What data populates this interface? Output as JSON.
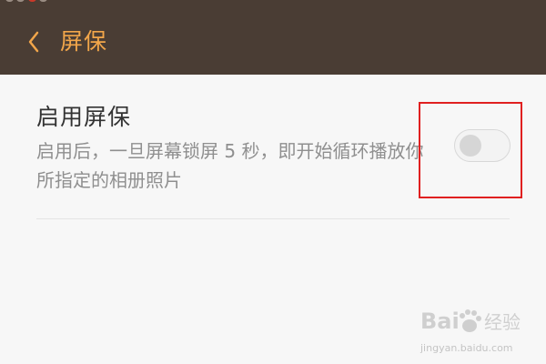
{
  "header": {
    "title": "屏保",
    "back_icon": "chevron-left-icon"
  },
  "setting": {
    "title": "启用屏保",
    "description": "启用后，一旦屏幕锁屏 5 秒，即开始循环播放你所指定的相册照片",
    "toggle_on": false
  },
  "watermark": {
    "text": "Bai经验",
    "url": "jingyan.baidu.com"
  },
  "colors": {
    "header_bg": "#4a3d34",
    "accent": "#f2a64a",
    "highlight_border": "#e02020",
    "background": "#f7f7f7"
  }
}
